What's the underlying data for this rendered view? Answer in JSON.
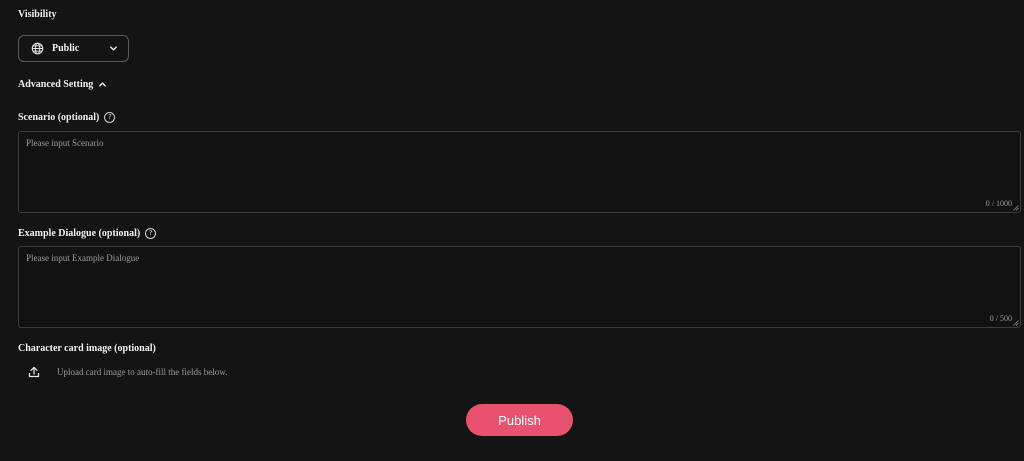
{
  "visibility": {
    "label": "Visibility",
    "selected": "Public"
  },
  "advanced": {
    "label": "Advanced Setting"
  },
  "scenario": {
    "label": "Scenario (optional)",
    "placeholder": "Please input Scenario",
    "counter": "0 / 1000"
  },
  "dialogue": {
    "label": "Example Dialogue (optional)",
    "placeholder": "Please input Example Dialogue",
    "counter": "0 / 500"
  },
  "card_image": {
    "label": "Character card image (optional)",
    "upload_text": "Upload card image to auto-fill the fields below."
  },
  "publish": {
    "label": "Publish"
  },
  "colors": {
    "background": "#141414",
    "accent": "#e8526f"
  },
  "icons": {
    "visibility": "globe-icon",
    "dropdown": "chevron-down-icon",
    "advanced": "chevron-up-icon",
    "help": "help-circle-icon",
    "upload": "upload-icon"
  }
}
